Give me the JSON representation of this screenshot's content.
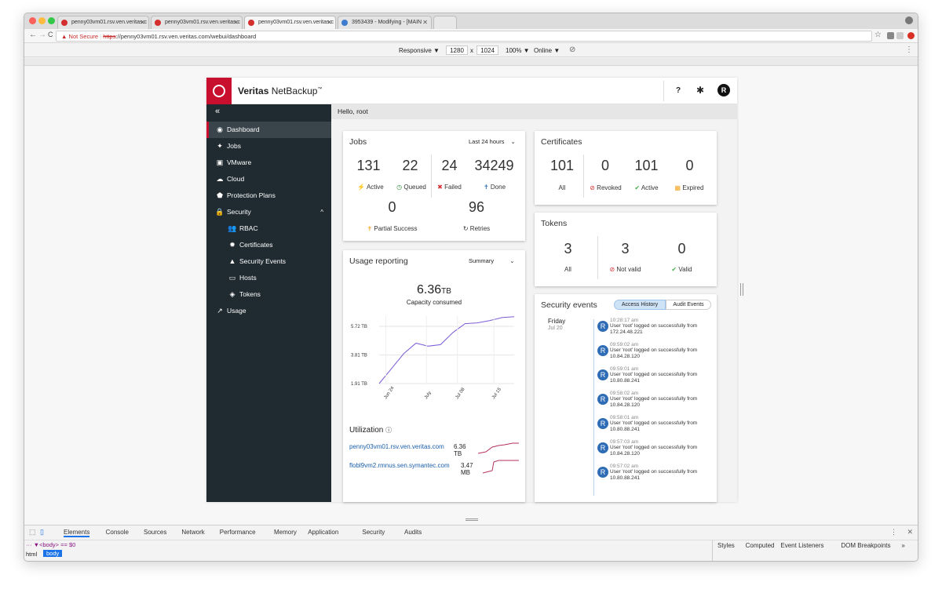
{
  "browser": {
    "tabs": [
      {
        "title": "penny03vm01.rsv.ven.veritas.c"
      },
      {
        "title": "penny03vm01.rsv.ven.veritas.c"
      },
      {
        "title": "penny03vm01.rsv.ven.veritas.c"
      },
      {
        "title": "3953439 - Modifying - [MAIN"
      }
    ],
    "not_secure": "Not Secure",
    "url_scheme": "https",
    "url_rest": "://penny03vm01.rsv.ven.veritas.com/webui/dashboard",
    "device_mode": {
      "responsive": "Responsive ▼",
      "width": "1280",
      "x": "x",
      "height": "1024",
      "zoom": "100% ▼",
      "network": "Online ▼"
    }
  },
  "app": {
    "brand_bold": "Veritas",
    "brand_rest": "NetBackup",
    "brand_tm": "™",
    "help_label": "?",
    "avatar_letter": "R",
    "collapse_label": "«",
    "hello": "Hello, root",
    "sidebar": {
      "items": [
        {
          "label": "Dashboard",
          "icon": "dashboard-icon",
          "glyph": "◉"
        },
        {
          "label": "Jobs",
          "icon": "jobs-icon",
          "glyph": "✦"
        },
        {
          "label": "VMware",
          "icon": "vmware-icon",
          "glyph": "▣"
        },
        {
          "label": "Cloud",
          "icon": "cloud-icon",
          "glyph": "☁"
        },
        {
          "label": "Protection Plans",
          "icon": "shield-icon",
          "glyph": "⬟"
        },
        {
          "label": "Security",
          "icon": "lock-icon",
          "glyph": "🔒",
          "caret": "^"
        },
        {
          "label": "RBAC",
          "icon": "users-icon",
          "glyph": "👥"
        },
        {
          "label": "Certificates",
          "icon": "certificate-icon",
          "glyph": "✹"
        },
        {
          "label": "Security Events",
          "icon": "warning-icon",
          "glyph": "▲"
        },
        {
          "label": "Hosts",
          "icon": "hosts-icon",
          "glyph": "▭"
        },
        {
          "label": "Tokens",
          "icon": "tag-icon",
          "glyph": "◈"
        },
        {
          "label": "Usage",
          "icon": "usage-icon",
          "glyph": "↗"
        }
      ]
    },
    "jobs": {
      "title": "Jobs",
      "range": "Last 24 hours",
      "active": {
        "value": "131",
        "label": "Active"
      },
      "queued": {
        "value": "22",
        "label": "Queued"
      },
      "failed": {
        "value": "24",
        "label": "Failed"
      },
      "done": {
        "value": "34249",
        "label": "Done"
      },
      "partial": {
        "value": "0",
        "label": "Partial Success"
      },
      "retries": {
        "value": "96",
        "label": "Retries"
      }
    },
    "certificates": {
      "title": "Certificates",
      "all": {
        "value": "101",
        "label": "All"
      },
      "revoked": {
        "value": "0",
        "label": "Revoked"
      },
      "active": {
        "value": "101",
        "label": "Active"
      },
      "expired": {
        "value": "0",
        "label": "Expired"
      }
    },
    "tokens": {
      "title": "Tokens",
      "all": {
        "value": "3",
        "label": "All"
      },
      "not_valid": {
        "value": "3",
        "label": "Not valid"
      },
      "valid": {
        "value": "0",
        "label": "Valid"
      }
    },
    "usage": {
      "title": "Usage reporting",
      "mode": "Summary",
      "capacity_value": "6.36",
      "capacity_unit": "TB",
      "capacity_label": "Capacity consumed"
    },
    "utilization": {
      "title": "Utilization",
      "rows": [
        {
          "host": "penny03vm01.rsv.ven.veritas.com",
          "value": "6.36",
          "unit": "TB"
        },
        {
          "host": "flobl9vm2.rmnus.sen.symantec.com",
          "value": "3.47",
          "unit": "MB"
        }
      ]
    },
    "security_events": {
      "title": "Security events",
      "tab_access": "Access History",
      "tab_audit": "Audit Events",
      "day": "Friday",
      "date": "Jul 20",
      "events": [
        {
          "time": "10:28:17 am",
          "msg": "User 'root' logged on successfully from",
          "ip": "172.24.48.221"
        },
        {
          "time": "09:59:02 am",
          "msg": "User 'root' logged on successfully from",
          "ip": "10.84.28.120"
        },
        {
          "time": "09:59:01 am",
          "msg": "User 'root' logged on successfully from",
          "ip": "10.80.88.241"
        },
        {
          "time": "09:58:02 am",
          "msg": "User 'root' logged on successfully from",
          "ip": "10.84.28.120"
        },
        {
          "time": "09:58:01 am",
          "msg": "User 'root' logged on successfully from",
          "ip": "10.80.88.241"
        },
        {
          "time": "09:57:03 am",
          "msg": "User 'root' logged on successfully from",
          "ip": "10.84.28.120"
        },
        {
          "time": "09:57:02 am",
          "msg": "User 'root' logged on successfully from",
          "ip": "10.80.88.241"
        }
      ]
    }
  },
  "devtools": {
    "tabs": [
      "Elements",
      "Console",
      "Sources",
      "Network",
      "Performance",
      "Memory",
      "Application",
      "Security",
      "Audits"
    ],
    "dom_line": "··· ▼<body> == $0",
    "crumb_html": "html",
    "crumb_body": "body",
    "side_tabs": [
      "Styles",
      "Computed",
      "Event Listeners",
      "DOM Breakpoints",
      "»"
    ]
  },
  "chart_data": {
    "type": "line",
    "title": "",
    "xlabel": "",
    "ylabel": "",
    "x": [
      "Jun 24",
      "",
      "July",
      "",
      "Jul 08",
      "",
      "Jul 15",
      ""
    ],
    "x_ticks": [
      "Jun 24",
      "July",
      "Jul 08",
      "Jul 15"
    ],
    "y_ticks": [
      "1.91 TB",
      "3.81 TB",
      "5.72 TB"
    ],
    "ylim": [
      1.91,
      6.4
    ],
    "series": [
      {
        "values": [
          1.91,
          2.9,
          3.9,
          4.6,
          4.4,
          4.5,
          5.3,
          5.9,
          5.95,
          6.1,
          6.3,
          6.36
        ]
      }
    ]
  }
}
